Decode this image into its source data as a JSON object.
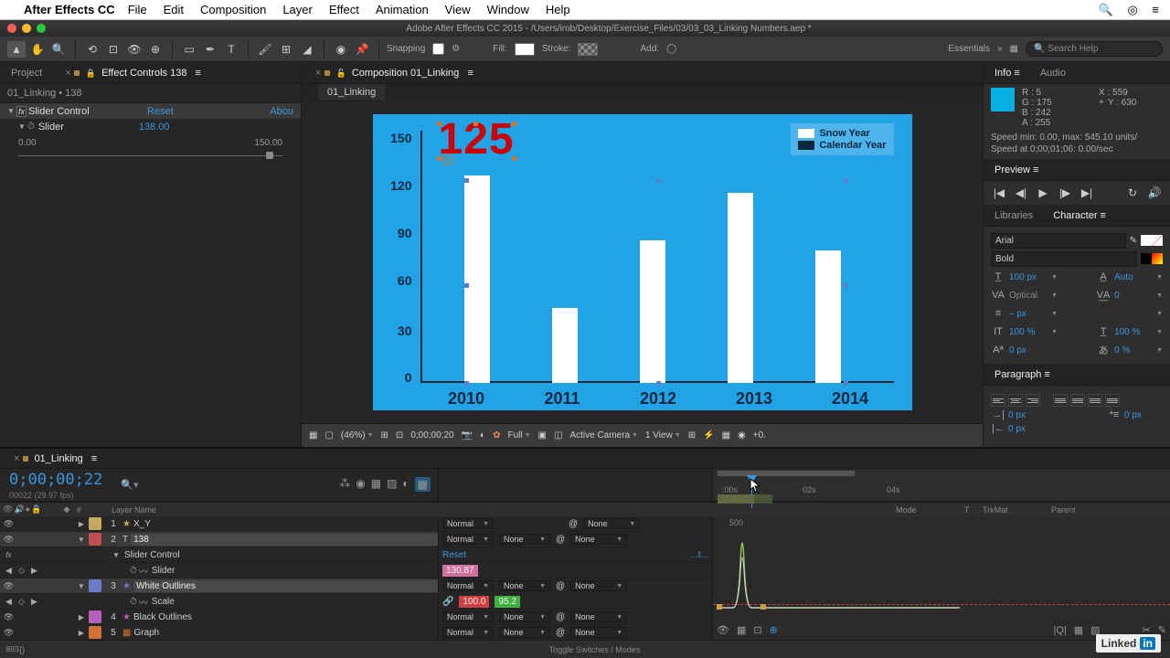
{
  "mac_menu": {
    "app_name": "After Effects CC",
    "items": [
      "File",
      "Edit",
      "Composition",
      "Layer",
      "Effect",
      "Animation",
      "View",
      "Window",
      "Help"
    ]
  },
  "window_title": "Adobe After Effects CC 2015 - /Users/irob/Desktop/Exercise_Files/03/03_03_Linking Numbers.aep *",
  "toolbar": {
    "snapping_label": "Snapping",
    "fill_label": "Fill:",
    "stroke_label": "Stroke:",
    "add_label": "Add:",
    "workspace": "Essentials",
    "search_placeholder": "Search Help"
  },
  "panels": {
    "project_tab": "Project",
    "effect_controls_tab": "Effect Controls 138",
    "comp_panel_tab": "Composition 01_Linking",
    "comp_subtab": "01_Linking",
    "info_tab": "Info",
    "audio_tab": "Audio",
    "preview_tab": "Preview",
    "libraries_tab": "Libraries",
    "character_tab": "Character",
    "paragraph_tab": "Paragraph"
  },
  "effect_controls": {
    "breadcrumb": "01_Linking • 138",
    "effect_name": "Slider Control",
    "reset": "Reset",
    "about": "Abou",
    "slider_label": "Slider",
    "slider_value": "138.00",
    "range_min": "0.00",
    "range_max": "150.00"
  },
  "chart_data": {
    "type": "bar",
    "categories": [
      "2010",
      "2011",
      "2012",
      "2013",
      "2014"
    ],
    "values": [
      125,
      45,
      85,
      115,
      80
    ],
    "y_ticks": [
      0,
      30,
      60,
      90,
      120,
      150
    ],
    "ylim": [
      0,
      150
    ],
    "legend": [
      {
        "label": "Snow Year",
        "color": "#ffffff"
      },
      {
        "label": "Calendar Year",
        "color": "#0a2740"
      }
    ],
    "big_number": "125"
  },
  "viewer_bar": {
    "zoom": "(46%)",
    "timecode": "0;00;00;20",
    "resolution": "Full",
    "camera": "Active Camera",
    "views": "1 View",
    "exposure": "+0."
  },
  "info": {
    "r": "R : 5",
    "g": "G : 175",
    "b": "B : 242",
    "a": "A : 255",
    "x": "X : 559",
    "y": "Y : 630",
    "speed1": "Speed min: 0.00, max: 545.10 units/",
    "speed2": "Speed at 0;00;01;06: 0.00/sec"
  },
  "character": {
    "font": "Arial",
    "style": "Bold",
    "size": "100 px",
    "auto": "Auto",
    "kerning": "Optical",
    "tracking": "0",
    "leading": "– px",
    "vscale": "100 %",
    "hscale": "100 %",
    "baseline": "0 px",
    "tsume": "0 %"
  },
  "paragraph": {
    "indent_left": "0 px",
    "indent_right": "0 px",
    "indent_first": "0 px"
  },
  "timeline": {
    "tab": "01_Linking",
    "timecode": "0;00;00;22",
    "timecode_sub": "00022 (29.97 fps)",
    "col_layer_name": "Layer Name",
    "col_mode": "Mode",
    "col_trkmat": "TrkMat",
    "col_parent": "Parent",
    "mode_normal": "Normal",
    "parent_none": "None",
    "layers": [
      {
        "num": "1",
        "color": "#c4a860",
        "name": "X_Y",
        "icon": "★"
      },
      {
        "num": "2",
        "color": "#c05050",
        "name": "138",
        "icon": "T",
        "selected": true
      },
      {
        "num": "",
        "color": "",
        "name": "Slider Control",
        "indent": 2,
        "prop": true
      },
      {
        "num": "",
        "color": "",
        "name": "Slider",
        "indent": 3,
        "prop": true,
        "stopwatch": true
      },
      {
        "num": "3",
        "color": "#6b7bc4",
        "name": "White Outlines",
        "icon": "★",
        "selected": true
      },
      {
        "num": "",
        "color": "",
        "name": "Scale",
        "indent": 2,
        "prop": true,
        "stopwatch": true
      },
      {
        "num": "4",
        "color": "#b860b8",
        "name": "Black Outlines",
        "icon": "★"
      },
      {
        "num": "5",
        "color": "#d27038",
        "name": "Graph",
        "icon": "▦"
      }
    ],
    "reset": "Reset",
    "ellipsis": "...t...",
    "slider_val": "130.87",
    "scale_val1": "100.0",
    "scale_val2": "95.2",
    "ruler_marks": [
      ":00s",
      "02s",
      "04s"
    ],
    "graph_label": "500",
    "footer": "Toggle Switches / Modes"
  },
  "linkedin": "Linked"
}
